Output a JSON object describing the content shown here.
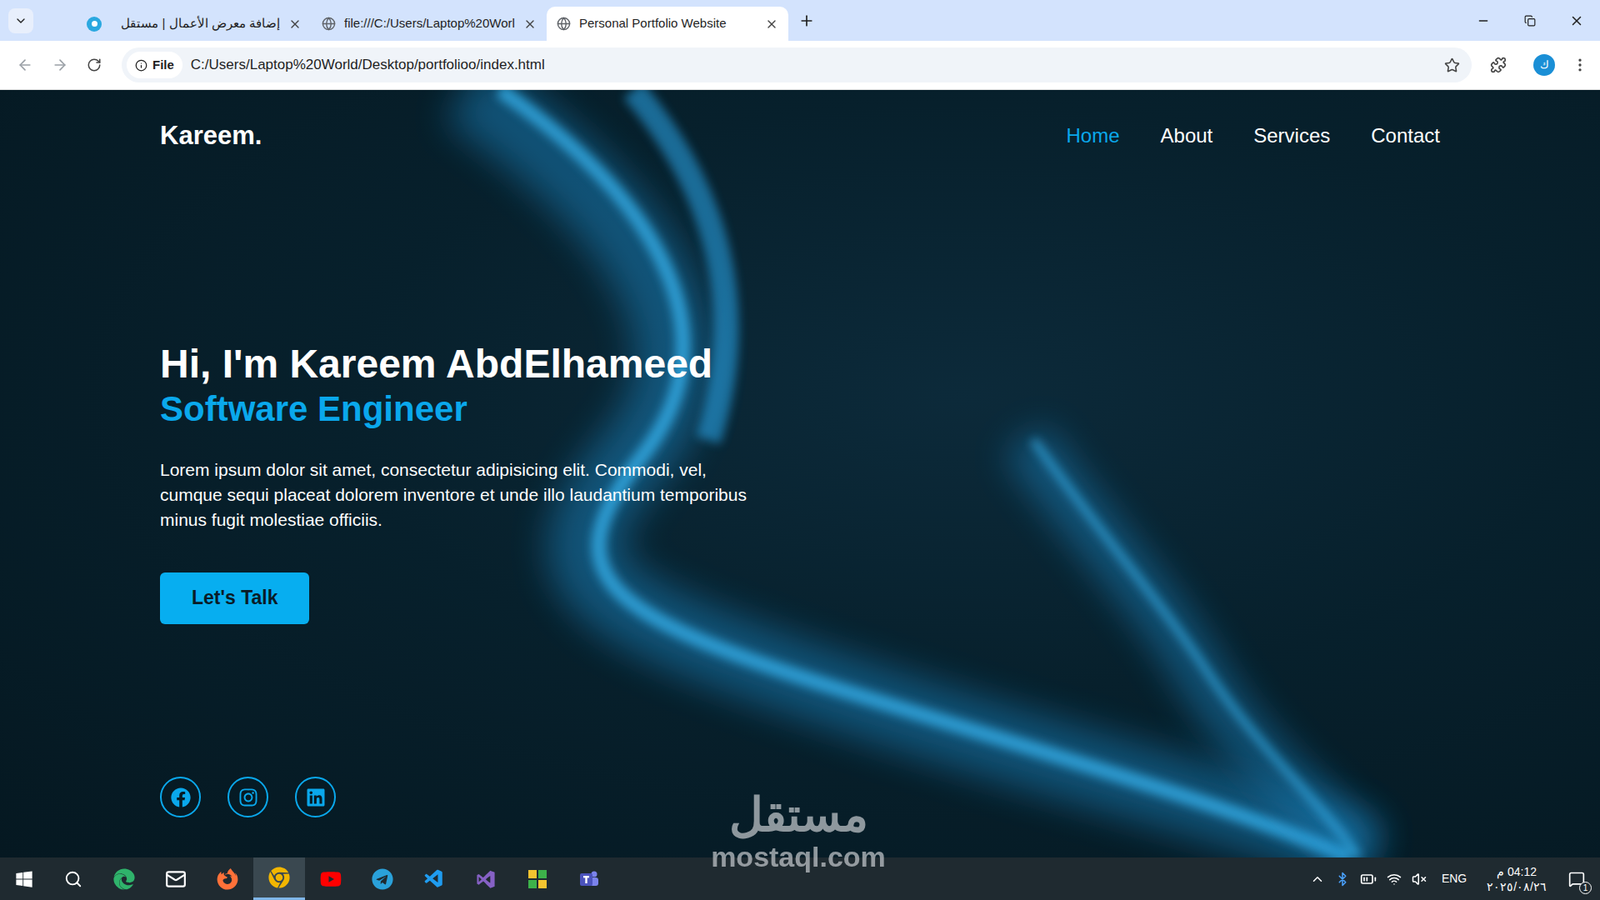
{
  "browser": {
    "tabs": [
      {
        "title": "إضافة معرض الأعمال | مستقل",
        "kind": "mostaql",
        "selected": false
      },
      {
        "title": "file:///C:/Users/Laptop%20Worl",
        "kind": "globe",
        "selected": false
      },
      {
        "title": "Personal Portfolio Website",
        "kind": "globe",
        "selected": true
      }
    ],
    "address": {
      "badge": "File",
      "url": "C:/Users/Laptop%20World/Desktop/portfolioo/index.html"
    },
    "profile": "ك"
  },
  "page": {
    "logo": "Kareem.",
    "nav": [
      {
        "label": "Home",
        "selected": true
      },
      {
        "label": "About",
        "selected": false
      },
      {
        "label": "Services",
        "selected": false
      },
      {
        "label": "Contact",
        "selected": false
      }
    ],
    "greeting": "Hi, I'm Kareem AbdElhameed",
    "role": "Software Engineer",
    "description": "Lorem ipsum dolor sit amet, consectetur adipisicing elit. Commodi, vel, cumque sequi placeat dolorem inventore et unde illo laudantium temporibus minus fugit molestiae officiis.",
    "cta": "Let's Talk",
    "socials": [
      {
        "kind": "facebook"
      },
      {
        "kind": "instagram"
      },
      {
        "kind": "linkedin"
      }
    ]
  },
  "watermark": {
    "arabic": "مستقل",
    "latin": "mostaql.com"
  },
  "taskbar": {
    "apps": [
      {
        "kind": "edge",
        "selected": false
      },
      {
        "kind": "mail",
        "selected": false
      },
      {
        "kind": "firefox",
        "selected": false
      },
      {
        "kind": "chrome",
        "selected": true
      },
      {
        "kind": "youtube",
        "selected": false
      },
      {
        "kind": "telegram",
        "selected": false
      },
      {
        "kind": "vscode",
        "selected": false
      },
      {
        "kind": "visualstudio",
        "selected": false
      },
      {
        "kind": "snip",
        "selected": false
      },
      {
        "kind": "teams",
        "selected": false
      }
    ],
    "tray": {
      "language": "ENG",
      "time": "04:12 م",
      "date": "٢٠٢٥/٠٨/٢٦",
      "notifications": "1"
    }
  }
}
